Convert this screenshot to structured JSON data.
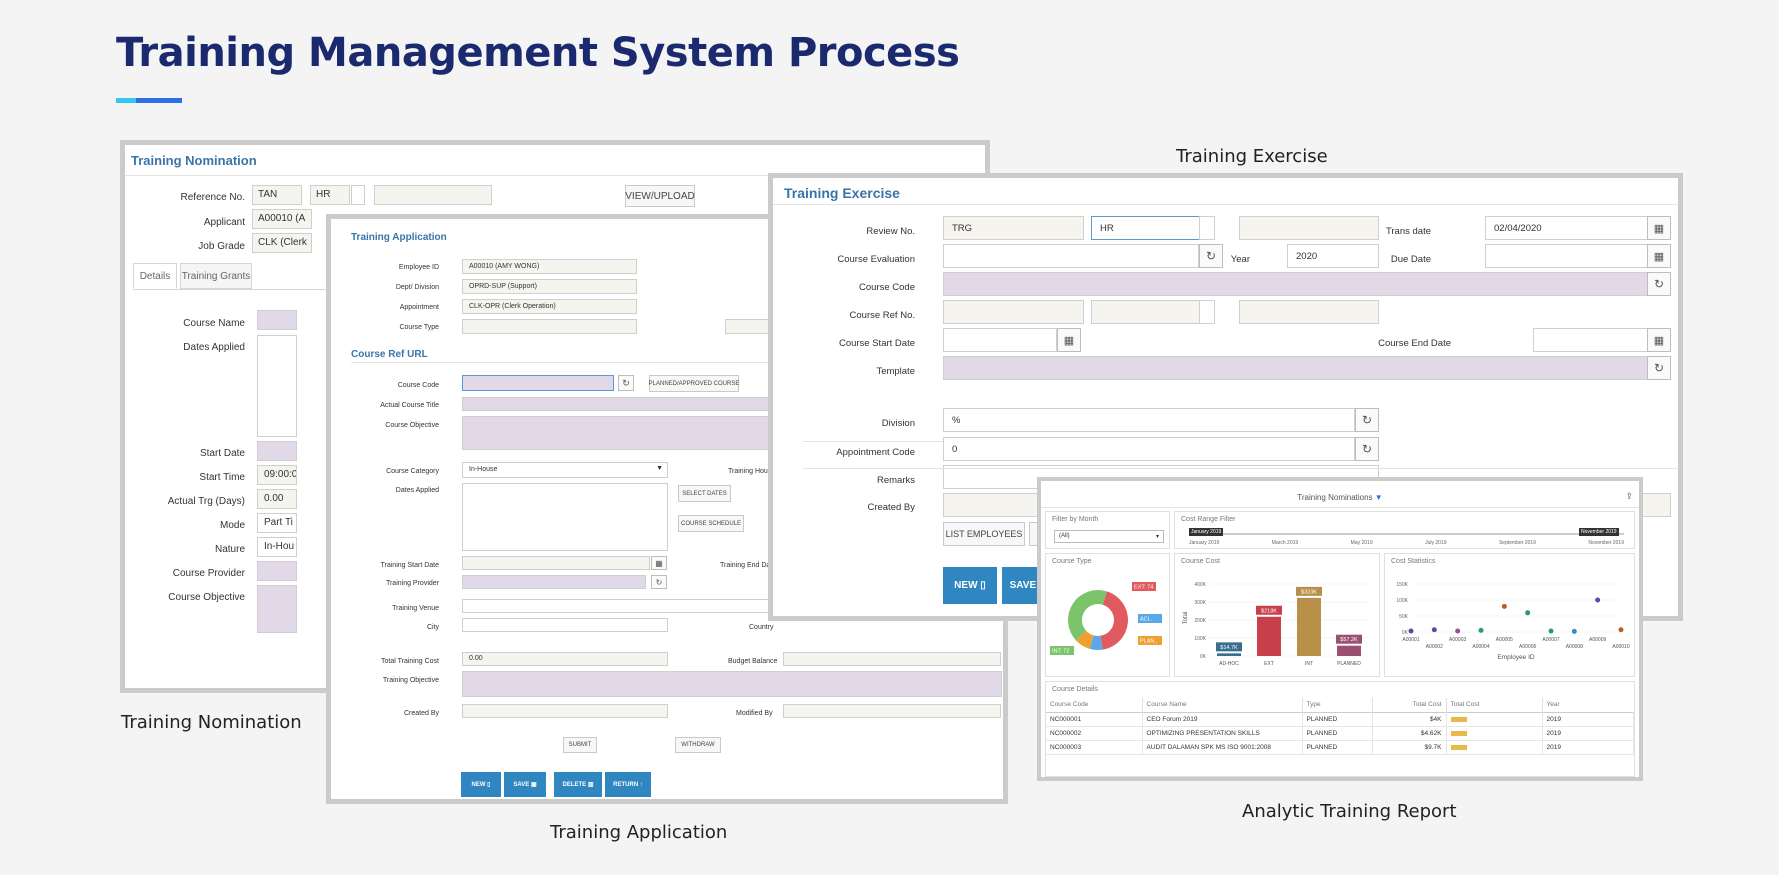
{
  "page": {
    "title": "Training Management System Process"
  },
  "captions": {
    "nomination": "Training Nomination",
    "application": "Training Application",
    "exercise": "Training Exercise",
    "report": "Analytic Training Report"
  },
  "nomination": {
    "title": "Training Nomination",
    "ref_label": "Reference No.",
    "ref_value": "TAN",
    "ref_value2": "HR",
    "view_upload": "VIEW/UPLOAD",
    "applicant_label": "Applicant",
    "applicant_value": "A00010 (A",
    "job_grade_label": "Job Grade",
    "job_grade_value": "CLK (Clerk",
    "tabs": [
      "Details",
      "Training Grants"
    ],
    "course_name_label": "Course Name",
    "dates_applied_label": "Dates Applied",
    "start_date_label": "Start Date",
    "start_time_label": "Start Time",
    "start_time_value": "09:00:0",
    "actual_trg_label": "Actual Trg (Days)",
    "actual_trg_value": "0.00",
    "mode_label": "Mode",
    "mode_value": "Part Ti",
    "nature_label": "Nature",
    "nature_value": "In-Hou",
    "course_provider_label": "Course Provider",
    "course_objective_label": "Course Objective"
  },
  "application": {
    "title": "Training Application",
    "employee_id_label": "Employee ID",
    "employee_id_value": "A00010 (AMY WONG)",
    "dept_label": "Dept/ Division",
    "dept_value": "OPRD-SUP (Support)",
    "appointment_label": "Appointment",
    "appointment_value": "CLK-OPR (Clerk Operation)",
    "course_type_label": "Course Type",
    "section_title": "Course Ref URL",
    "course_code_label": "Course Code",
    "planned_btn": "PLANNED/APPROVED COURSE",
    "actual_title_label": "Actual Course Title",
    "objective_label": "Course Objective",
    "category_label": "Course Category",
    "category_value": "In-House",
    "training_hours_label": "Training Hours",
    "dates_applied_label": "Dates Applied",
    "select_dates": "SELECT DATES",
    "course_schedule": "COURSE SCHEDULE",
    "start_date_label": "Training Start Date",
    "end_date_label": "Training End Date",
    "provider_label": "Training Provider",
    "venue_label": "Training Venue",
    "city_label": "City",
    "country_label": "Country",
    "total_cost_label": "Total Training Cost",
    "total_cost_value": "0.00",
    "budget_label": "Budget Balance",
    "training_objective_label": "Training Objective",
    "created_by_label": "Created By",
    "modified_by_label": "Modified By",
    "submit": "SUBMIT",
    "withdraw": "WITHDRAW",
    "new": "NEW",
    "save": "SAVE",
    "delete": "DELETE",
    "return": "RETURN"
  },
  "exercise": {
    "title": "Training Exercise",
    "review_label": "Review No.",
    "review_value": "TRG",
    "review_value2": "HR",
    "trans_date_label": "Trans date",
    "trans_date_value": "02/04/2020",
    "evaluation_label": "Course Evaluation",
    "year_label": "Year",
    "year_value": "2020",
    "due_date_label": "Due Date",
    "course_code_label": "Course Code",
    "course_ref_label": "Course Ref No.",
    "start_date_label": "Course Start Date",
    "end_date_label": "Course End Date",
    "template_label": "Template",
    "division_label": "Division",
    "division_value": "%",
    "appointment_label": "Appointment Code",
    "appointment_value": "0",
    "remarks_label": "Remarks",
    "created_by_label": "Created By",
    "list_employees": "LIST EMPLOYEES",
    "n_btn": "N",
    "new": "NEW",
    "save": "SAVE"
  },
  "report": {
    "title": "Training Nominations",
    "filter_label": "Filter by Month",
    "filter_value": "(All)",
    "cost_range_label": "Cost Range Filter",
    "range_start": "January 2019",
    "range_end": "November 2019",
    "months": [
      "January 2019",
      "March 2019",
      "May 2019",
      "July 2019",
      "September 2019",
      "November 2019"
    ],
    "course_type_label": "Course Type",
    "course_cost_label": "Course Cost",
    "cost_stats_label": "Cost Statistics",
    "details_label": "Course Details",
    "table_headers": [
      "Course Code",
      "Course Name",
      "Type",
      "Total Cost",
      "Total Cost",
      "Year"
    ],
    "rows": [
      {
        "code": "NC000001",
        "name": "CEO Forum 2019",
        "type": "PLANNED",
        "cost": "$4K",
        "year": "2019"
      },
      {
        "code": "NC000002",
        "name": "OPTIMIZING PRESENTATION SKILLS",
        "type": "PLANNED",
        "cost": "$4.62K",
        "year": "2019"
      },
      {
        "code": "NC000003",
        "name": "AUDIT DALAMAN SPK MS ISO 9001:2008",
        "type": "PLANNED",
        "cost": "$9.7K",
        "year": "2019"
      }
    ]
  },
  "chart_data": [
    {
      "type": "pie",
      "title": "Course Type",
      "labels": [
        "EXT: 74",
        "ACI..",
        "PLAN..",
        "INT: 72"
      ],
      "values": [
        74,
        12,
        15,
        72
      ],
      "colors": [
        "#e05a5f",
        "#5aa9e6",
        "#f0a030",
        "#7cc46b"
      ]
    },
    {
      "type": "bar",
      "title": "Course Cost",
      "ylabel": "Total",
      "categories": [
        "AD-HOC",
        "EXT",
        "INT",
        "PLANNED"
      ],
      "values": [
        14.7,
        218,
        323,
        57.2
      ],
      "labels": [
        "$14.7K",
        "$218K",
        "$323K",
        "$57.2K"
      ],
      "colors": [
        "#3a6e8f",
        "#c8404a",
        "#b8904a",
        "#9a5070"
      ],
      "yticks": [
        "0K",
        "100K",
        "200K",
        "300K",
        "400K"
      ],
      "ylim": [
        0,
        400
      ]
    },
    {
      "type": "scatter",
      "title": "Cost Statistics",
      "xlabel": "Employee ID",
      "yticks": [
        "0K",
        "50K",
        "100K",
        "150K"
      ],
      "ylim": [
        0,
        150
      ],
      "x_top": [
        "A00001",
        "A00003",
        "A00005",
        "A00007",
        "A00009"
      ],
      "x_bottom": [
        "A00002",
        "A00004",
        "A00006",
        "A00008",
        "A00010"
      ],
      "points": [
        {
          "x": "A00001",
          "y": 3,
          "c": "#5a4a9a"
        },
        {
          "x": "A00002",
          "y": 7,
          "c": "#5a4a9a"
        },
        {
          "x": "A00003",
          "y": 3,
          "c": "#a04a8a"
        },
        {
          "x": "A00004",
          "y": 5,
          "c": "#2a9a6a"
        },
        {
          "x": "A00005",
          "y": 80,
          "c": "#c05a30"
        },
        {
          "x": "A00006",
          "y": 60,
          "c": "#2a9a6a"
        },
        {
          "x": "A00007",
          "y": 3,
          "c": "#2a9a6a"
        },
        {
          "x": "A00008",
          "y": 2,
          "c": "#3a8ac0"
        },
        {
          "x": "A00009",
          "y": 100,
          "c": "#5a4ab0"
        },
        {
          "x": "A00010",
          "y": 7,
          "c": "#c05a30"
        }
      ]
    }
  ]
}
